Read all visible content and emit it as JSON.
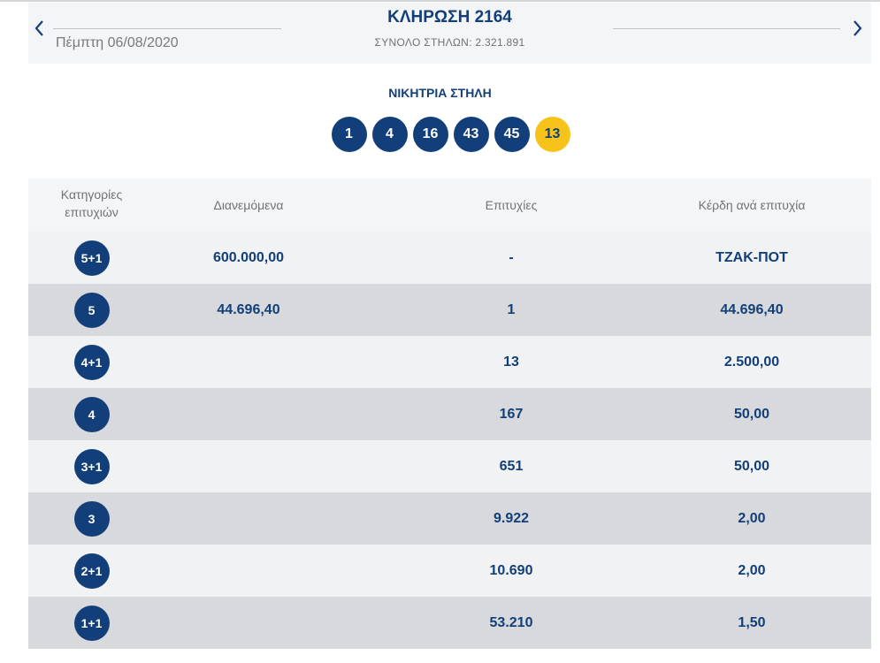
{
  "header": {
    "title": "ΚΛΗΡΩΣΗ 2164",
    "date": "Πέμπτη 06/08/2020",
    "total_columns": "ΣΥΝΟΛΟ ΣΤΗΛΩΝ: 2.321.891",
    "prev_icon": "chevron-left-icon",
    "next_icon": "chevron-right-icon"
  },
  "winning": {
    "label": "ΝΙΚΗΤΡΙΑ ΣΤΗΛΗ",
    "numbers": [
      "1",
      "4",
      "16",
      "43",
      "45"
    ],
    "bonus": "13"
  },
  "table": {
    "headers": {
      "category_line1": "Κατηγορίες",
      "category_line2": "επιτυχιών",
      "distributed": "Διανεμόμενα",
      "winners": "Επιτυχίες",
      "prize": "Κέρδη ανά επιτυχία"
    },
    "rows": [
      {
        "category": "5+1",
        "distributed": "600.000,00",
        "winners": "-",
        "prize": "ΤΖΑΚ-ΠΟΤ"
      },
      {
        "category": "5",
        "distributed": "44.696,40",
        "winners": "1",
        "prize": "44.696,40"
      },
      {
        "category": "4+1",
        "distributed": "",
        "winners": "13",
        "prize": "2.500,00"
      },
      {
        "category": "4",
        "distributed": "",
        "winners": "167",
        "prize": "50,00"
      },
      {
        "category": "3+1",
        "distributed": "",
        "winners": "651",
        "prize": "50,00"
      },
      {
        "category": "3",
        "distributed": "",
        "winners": "9.922",
        "prize": "2,00"
      },
      {
        "category": "2+1",
        "distributed": "",
        "winners": "10.690",
        "prize": "2,00"
      },
      {
        "category": "1+1",
        "distributed": "",
        "winners": "53.210",
        "prize": "1,50"
      }
    ]
  },
  "colors": {
    "brand_blue": "#123f79",
    "bonus_yellow": "#f6c31a"
  }
}
